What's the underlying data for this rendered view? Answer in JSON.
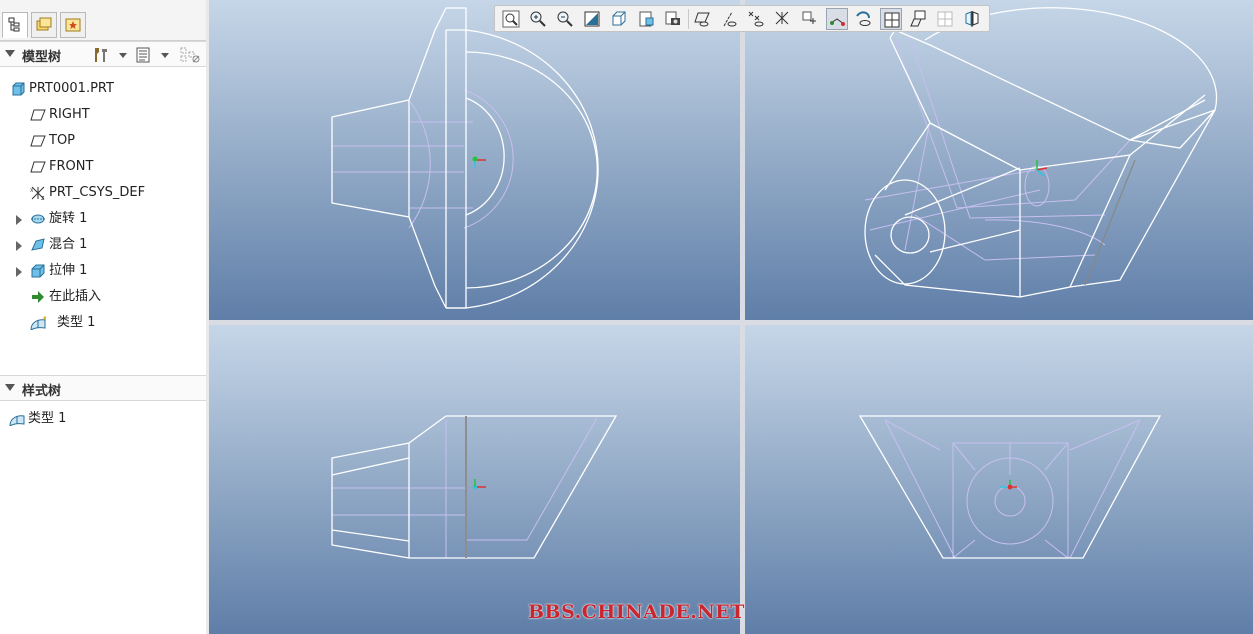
{
  "panel_tabs": [
    {
      "icon": "model-tree-tab-icon",
      "active": true
    },
    {
      "icon": "folder-browser-tab-icon",
      "active": false
    },
    {
      "icon": "favorites-tab-icon",
      "active": false
    }
  ],
  "model_tree": {
    "title": "模型树",
    "items": [
      {
        "label": "PRT0001.PRT",
        "icon": "part-icon"
      },
      {
        "label": "RIGHT",
        "icon": "datum-plane-icon"
      },
      {
        "label": "TOP",
        "icon": "datum-plane-icon"
      },
      {
        "label": "FRONT",
        "icon": "datum-plane-icon"
      },
      {
        "label": "PRT_CSYS_DEF",
        "icon": "csys-icon"
      },
      {
        "label": "旋转 1",
        "icon": "revolve-icon"
      },
      {
        "label": "混合 1",
        "icon": "blend-icon"
      },
      {
        "label": "拉伸 1",
        "icon": "extrude-icon"
      },
      {
        "label": "在此插入",
        "icon": "insert-here-arrow-icon"
      },
      {
        "label": "类型 1",
        "icon": "style-feature-icon"
      }
    ]
  },
  "style_tree": {
    "title": "样式树",
    "items": [
      {
        "label": "类型 1",
        "icon": "style-feature-icon"
      }
    ]
  },
  "view_toolbar": {
    "buttons": [
      {
        "name": "refit-icon",
        "on": false
      },
      {
        "name": "zoom-in-icon",
        "on": false
      },
      {
        "name": "zoom-out-icon",
        "on": false
      },
      {
        "name": "repaint-icon",
        "on": false
      },
      {
        "name": "display-style-icon",
        "on": false
      },
      {
        "name": "saved-orientations-icon",
        "on": false
      },
      {
        "name": "view-manager-icon",
        "on": false
      },
      {
        "name": "plane-display-icon",
        "on": false
      },
      {
        "name": "axis-display-icon",
        "on": false
      },
      {
        "name": "point-display-icon",
        "on": false
      },
      {
        "name": "csys-display-icon",
        "on": false
      },
      {
        "name": "spin-center-icon",
        "on": false
      },
      {
        "name": "curve-display-icon",
        "on": true
      },
      {
        "name": "annotation-display-icon",
        "on": false
      },
      {
        "name": "four-views-icon",
        "on": true
      },
      {
        "name": "three-d-view-icon",
        "on": false
      },
      {
        "name": "view-layout-icon",
        "on": false
      },
      {
        "name": "mirror-view-icon",
        "on": false
      }
    ]
  },
  "colors": {
    "viewport_top": "#c6d6e8",
    "viewport_bottom": "#5f7ea8",
    "model_edge": "#ffffff",
    "hidden_edge": "#c7bff0",
    "watermark": "#c9262f"
  },
  "watermark": "BBS.CHINADE.NET"
}
